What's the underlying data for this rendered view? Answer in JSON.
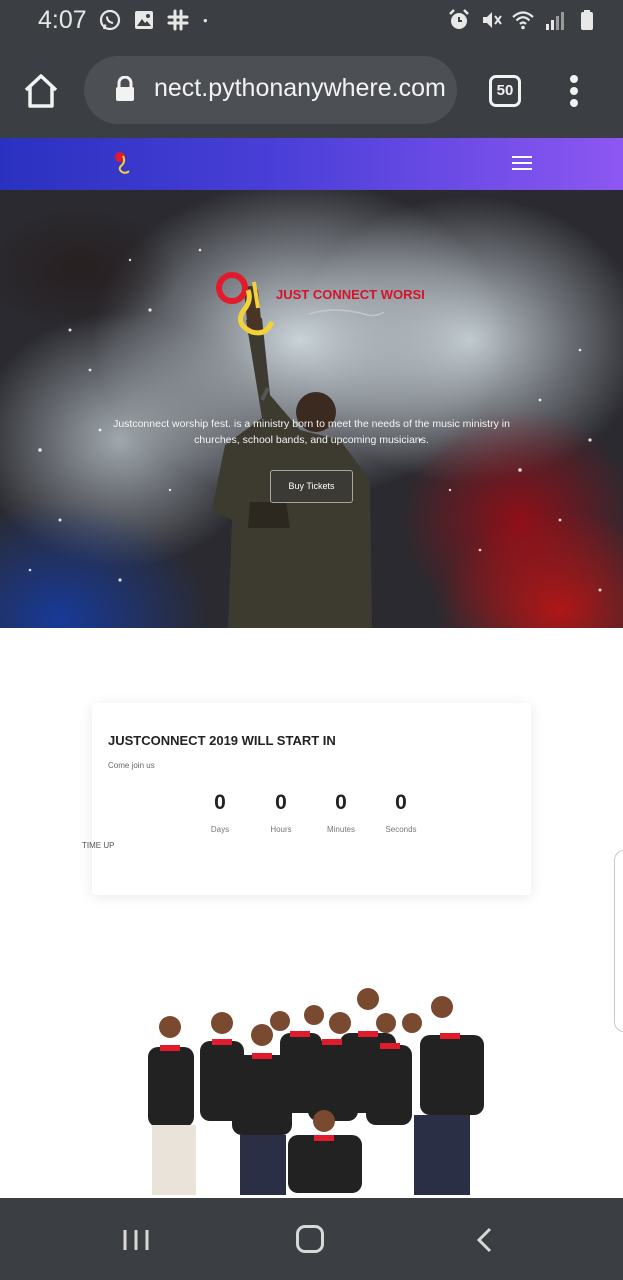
{
  "status_bar": {
    "time": "4:07",
    "left_icons": [
      "whatsapp-icon",
      "gallery-icon",
      "slack-icon",
      "dot-icon"
    ],
    "right_icons": [
      "alarm-icon",
      "mute-icon",
      "wifi-icon",
      "signal-icon",
      "battery-icon"
    ]
  },
  "browser": {
    "url": "nect.pythonanywhere.com",
    "tab_count": "50"
  },
  "hero": {
    "logo_text": "JUST CONNECT WORSHIP FESTIVAL",
    "description": "Justconnect worship fest. is a ministry born to meet the needs of the music ministry in churches, school bands, and upcoming musicians.",
    "button_label": "Buy Tickets"
  },
  "countdown": {
    "title": "JUSTCONNECT 2019 WILL START IN",
    "subtitle": "Come join us",
    "units": [
      {
        "value": "0",
        "label": "Days"
      },
      {
        "value": "0",
        "label": "Hours"
      },
      {
        "value": "0",
        "label": "Minutes"
      },
      {
        "value": "0",
        "label": "Seconds"
      }
    ],
    "status": "TIME UP"
  },
  "colors": {
    "nav_gradient_start": "#2a31c0",
    "nav_gradient_end": "#8d57f2",
    "system_bar": "#3b3e42"
  }
}
